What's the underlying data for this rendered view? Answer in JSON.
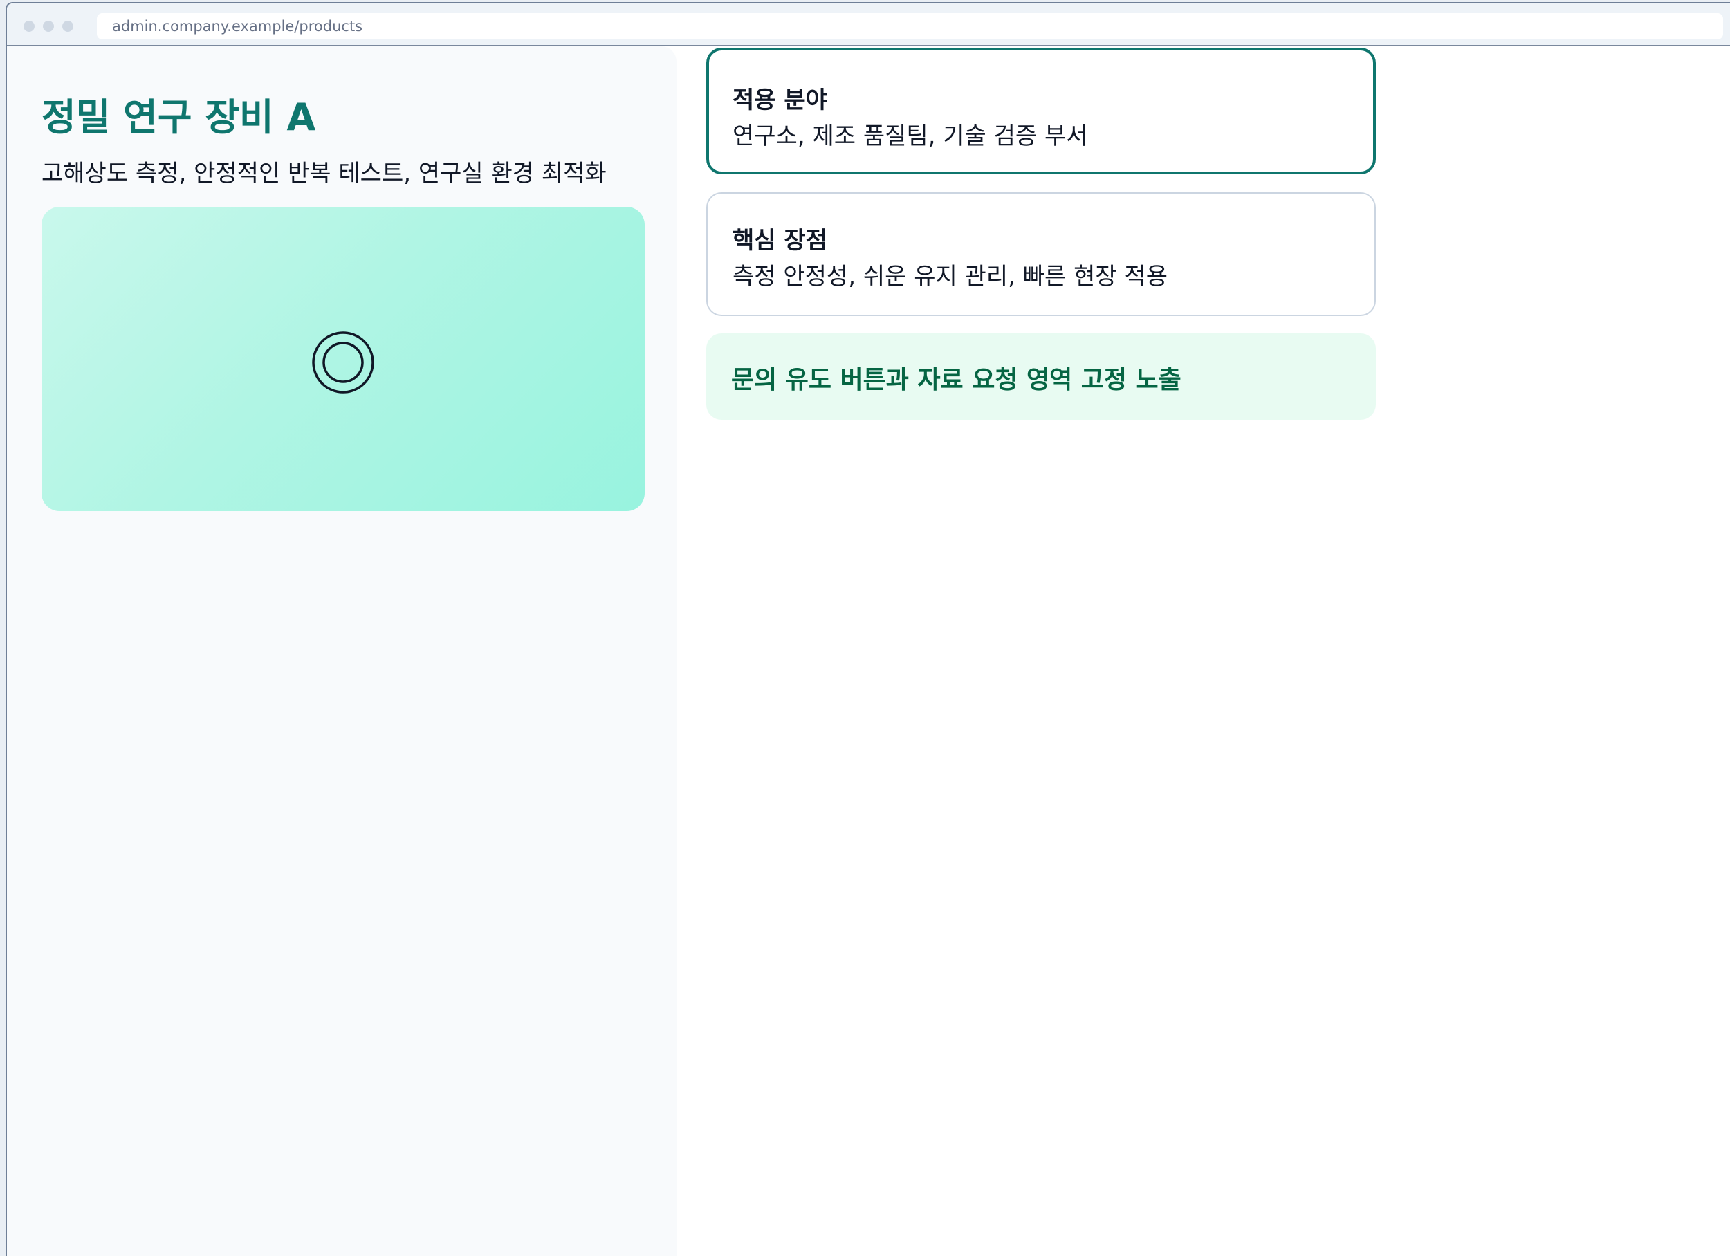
{
  "browser": {
    "url": "admin.company.example/products"
  },
  "product": {
    "title": "정밀 연구 장비 A",
    "description": "고해상도 측정, 안정적인 반복 테스트, 연구실 환경 최적화",
    "media_icon": "target-icon"
  },
  "cards": {
    "application": {
      "title": "적용 분야",
      "text": "연구소, 제조 품질팀, 기술 검증 부서"
    },
    "advantages": {
      "title": "핵심 장점",
      "text": "측정 안정성, 쉬운 유지 관리, 빠른 현장 적용"
    },
    "cta": {
      "text": "문의 유도 버튼과 자료 요청 영역 고정 노출"
    }
  },
  "colors": {
    "accent": "#0f766e",
    "cta_text": "#056543",
    "cta_background": "#e8fbf2",
    "media_gradient_start": "#c9f8ec",
    "media_gradient_end": "#98f3df"
  }
}
